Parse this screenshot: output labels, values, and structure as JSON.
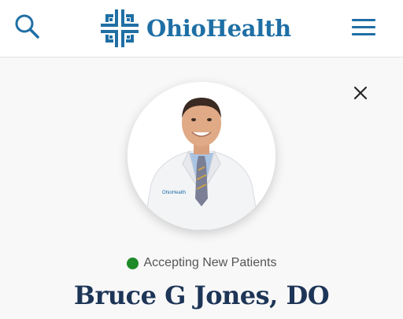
{
  "header": {
    "logo_text": "OhioHealth",
    "search_icon": "search-icon",
    "menu_icon": "hamburger-menu-icon",
    "brand_color": "#1f6fa5"
  },
  "profile": {
    "close_icon": "close-icon",
    "photo_alt": "Bruce G Jones, DO",
    "coat_logo_text": "OhioHealth",
    "status_text": "Accepting New Patients",
    "status_color": "#1e8a2a",
    "name": "Bruce G Jones, DO"
  }
}
